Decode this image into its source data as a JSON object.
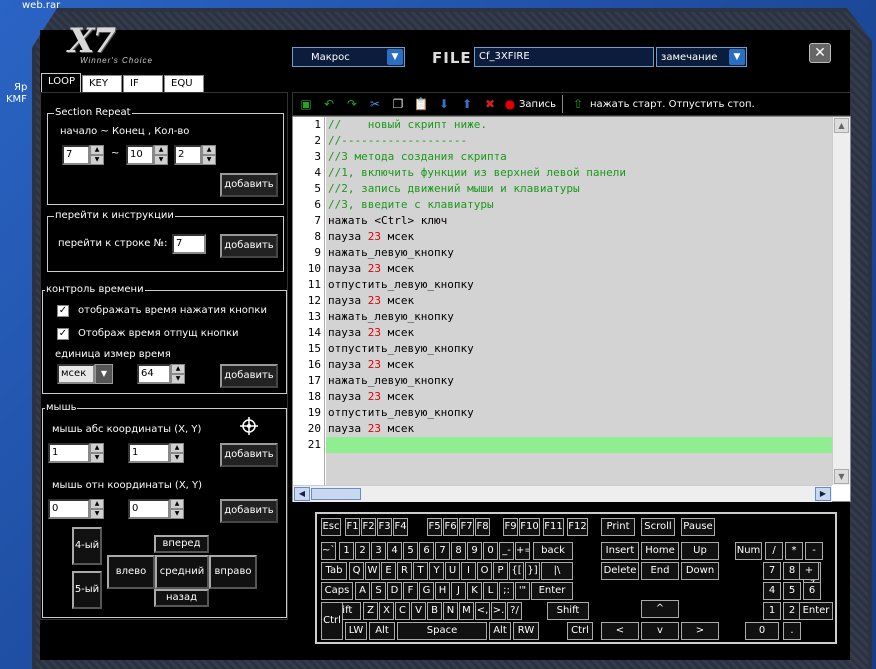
{
  "desktop": {
    "icon1": "web.rar",
    "icon2": "Яр",
    "icon3": "KMF"
  },
  "brand": {
    "logo": "X7",
    "tagline": "Winner's Choice"
  },
  "header": {
    "macro_combo": "Макрос",
    "file_label": "FILE",
    "file_name": "Cf_3XFIRE",
    "note_combo": "замечание",
    "close": "✕"
  },
  "tabs": [
    {
      "label": "LOOP",
      "active": true
    },
    {
      "label": "KEY",
      "active": false
    },
    {
      "label": "IF",
      "active": false
    },
    {
      "label": "EQU",
      "active": false
    }
  ],
  "section_repeat": {
    "title": "Section Repeat",
    "hint": "начало ~ Конец , Кол-во",
    "start": "7",
    "tilde": "~",
    "end": "10",
    "count": "2",
    "add": "добавить"
  },
  "goto": {
    "title": "перейти к инструкции",
    "label": "перейти к строке №:",
    "value": "7",
    "add": "добавить"
  },
  "time_control": {
    "title": "контроль времени",
    "show_press": "отображать время нажатия кнопки",
    "show_release": "Отображ время отпущ кнопки",
    "unit_label": "единица измер время",
    "unit": "мсек",
    "value": "64",
    "add": "добавить"
  },
  "mouse": {
    "title": "мышь",
    "abs_label": "мышь абс координаты (X, Y)",
    "abs_x": "1",
    "abs_y": "1",
    "rel_label": "мышь отн координаты (X, Y)",
    "rel_x": "0",
    "rel_y": "0",
    "add": "добавить",
    "add2": "добавить",
    "btn4": "4-ый",
    "btn5": "5-ый",
    "up": "вперед",
    "left": "влево",
    "middle": "средний",
    "right": "вправо",
    "down": "назад"
  },
  "toolbar": {
    "record": "Запись",
    "hint": "нажать старт. Отпустить стоп."
  },
  "editor": {
    "lines": [
      {
        "n": "1",
        "segs": [
          {
            "t": "//    новый скрипт ниже.",
            "c": "cm"
          }
        ]
      },
      {
        "n": "2",
        "segs": [
          {
            "t": "//-------------------",
            "c": "cm"
          }
        ]
      },
      {
        "n": "3",
        "segs": [
          {
            "t": "//3 метода создания скрипта",
            "c": "cm"
          }
        ]
      },
      {
        "n": "4",
        "segs": [
          {
            "t": "//1, включить функции из верхней левой панели",
            "c": "cm"
          }
        ]
      },
      {
        "n": "5",
        "segs": [
          {
            "t": "//2, запись движений мыши и клавиатуры",
            "c": "cm"
          }
        ]
      },
      {
        "n": "6",
        "segs": [
          {
            "t": "//3, введите с клавиатуры",
            "c": "cm"
          }
        ]
      },
      {
        "n": "7",
        "segs": [
          {
            "t": "нажать <Ctrl> ключ",
            "c": ""
          }
        ]
      },
      {
        "n": "8",
        "segs": [
          {
            "t": "пауза ",
            "c": ""
          },
          {
            "t": "23",
            "c": "num"
          },
          {
            "t": " мсек",
            "c": ""
          }
        ]
      },
      {
        "n": "9",
        "segs": [
          {
            "t": "нажать_левую_кнопку",
            "c": ""
          }
        ]
      },
      {
        "n": "10",
        "segs": [
          {
            "t": "пауза ",
            "c": ""
          },
          {
            "t": "23",
            "c": "num"
          },
          {
            "t": " мсек",
            "c": ""
          }
        ]
      },
      {
        "n": "11",
        "segs": [
          {
            "t": "отпустить_левую_кнопку",
            "c": ""
          }
        ]
      },
      {
        "n": "12",
        "segs": [
          {
            "t": "пауза ",
            "c": ""
          },
          {
            "t": "23",
            "c": "num"
          },
          {
            "t": " мсек",
            "c": ""
          }
        ]
      },
      {
        "n": "13",
        "segs": [
          {
            "t": "нажать_левую_кнопку",
            "c": ""
          }
        ]
      },
      {
        "n": "14",
        "segs": [
          {
            "t": "пауза ",
            "c": ""
          },
          {
            "t": "23",
            "c": "num"
          },
          {
            "t": " мсек",
            "c": ""
          }
        ]
      },
      {
        "n": "15",
        "segs": [
          {
            "t": "отпустить_левую_кнопку",
            "c": ""
          }
        ]
      },
      {
        "n": "16",
        "segs": [
          {
            "t": "пауза ",
            "c": ""
          },
          {
            "t": "23",
            "c": "num"
          },
          {
            "t": " мсек",
            "c": ""
          }
        ]
      },
      {
        "n": "17",
        "segs": [
          {
            "t": "нажать_левую_кнопку",
            "c": ""
          }
        ]
      },
      {
        "n": "18",
        "segs": [
          {
            "t": "пауза ",
            "c": ""
          },
          {
            "t": "23",
            "c": "num"
          },
          {
            "t": " мсек",
            "c": ""
          }
        ]
      },
      {
        "n": "19",
        "segs": [
          {
            "t": "отпустить_левую_кнопку",
            "c": ""
          }
        ]
      },
      {
        "n": "20",
        "segs": [
          {
            "t": "пауза ",
            "c": ""
          },
          {
            "t": "23",
            "c": "num"
          },
          {
            "t": " мсек",
            "c": ""
          }
        ]
      },
      {
        "n": "21",
        "segs": [
          {
            "t": "",
            "c": ""
          }
        ],
        "current": true
      }
    ]
  },
  "keyboard": {
    "keys": [
      {
        "k": "Esc"
      },
      {
        "k": "F1"
      },
      {
        "k": "F2"
      },
      {
        "k": "F3"
      },
      {
        "k": "F4"
      },
      {
        "k": "F5"
      },
      {
        "k": "F6"
      },
      {
        "k": "F7"
      },
      {
        "k": "F8"
      },
      {
        "k": "F9"
      },
      {
        "k": "F10"
      },
      {
        "k": "F11"
      },
      {
        "k": "F12"
      },
      {
        "k": "Print"
      },
      {
        "k": "Scroll"
      },
      {
        "k": "Pause"
      },
      {
        "k": "~`"
      },
      {
        "k": "1"
      },
      {
        "k": "2"
      },
      {
        "k": "3"
      },
      {
        "k": "4"
      },
      {
        "k": "5"
      },
      {
        "k": "6"
      },
      {
        "k": "7"
      },
      {
        "k": "8"
      },
      {
        "k": "9"
      },
      {
        "k": "0"
      },
      {
        "k": "_-"
      },
      {
        "k": "+="
      },
      {
        "k": "back"
      },
      {
        "k": "Insert"
      },
      {
        "k": "Home"
      },
      {
        "k": "Up"
      },
      {
        "k": "Num"
      },
      {
        "k": "/"
      },
      {
        "k": "*"
      },
      {
        "k": "-"
      },
      {
        "k": "Tab"
      },
      {
        "k": "Q"
      },
      {
        "k": "W"
      },
      {
        "k": "E"
      },
      {
        "k": "R"
      },
      {
        "k": "T"
      },
      {
        "k": "Y"
      },
      {
        "k": "U"
      },
      {
        "k": "I"
      },
      {
        "k": "O"
      },
      {
        "k": "P"
      },
      {
        "k": "{["
      },
      {
        "k": "}]"
      },
      {
        "k": "|\\"
      },
      {
        "k": "Delete"
      },
      {
        "k": "End"
      },
      {
        "k": "Down"
      },
      {
        "k": "7"
      },
      {
        "k": "8"
      },
      {
        "k": "9"
      },
      {
        "k": "+"
      },
      {
        "k": "Caps"
      },
      {
        "k": "A"
      },
      {
        "k": "S"
      },
      {
        "k": "D"
      },
      {
        "k": "F"
      },
      {
        "k": "G"
      },
      {
        "k": "H"
      },
      {
        "k": "J"
      },
      {
        "k": "K"
      },
      {
        "k": "L"
      },
      {
        "k": ";:"
      },
      {
        "k": "'\""
      },
      {
        "k": "Enter"
      },
      {
        "k": "4"
      },
      {
        "k": "5"
      },
      {
        "k": "6"
      },
      {
        "k": "Shift"
      },
      {
        "k": "Z"
      },
      {
        "k": "X"
      },
      {
        "k": "C"
      },
      {
        "k": "V"
      },
      {
        "k": "B"
      },
      {
        "k": "N"
      },
      {
        "k": "M"
      },
      {
        "k": "<,"
      },
      {
        "k": ">."
      },
      {
        "k": "?/"
      },
      {
        "k": "Shift"
      },
      {
        "k": "^"
      },
      {
        "k": "1"
      },
      {
        "k": "2"
      },
      {
        "k": "3"
      },
      {
        "k": "Enter"
      },
      {
        "k": "Ctrl"
      },
      {
        "k": "LW"
      },
      {
        "k": "Alt"
      },
      {
        "k": "Space"
      },
      {
        "k": "Alt"
      },
      {
        "k": "RW"
      },
      {
        "k": "Ctrl"
      },
      {
        "k": "<"
      },
      {
        "k": "v"
      },
      {
        "k": ">"
      },
      {
        "k": "0"
      },
      {
        "k": "."
      }
    ]
  }
}
